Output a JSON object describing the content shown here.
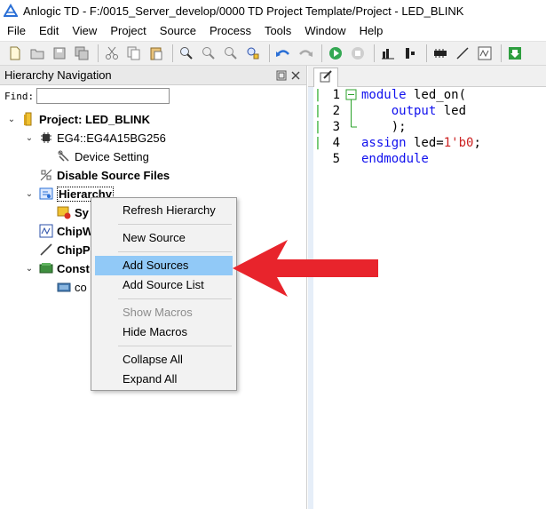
{
  "window": {
    "title": "Anlogic TD - F:/0015_Server_develop/0000 TD Project Template/Project - LED_BLINK"
  },
  "menubar": {
    "items": [
      "File",
      "Edit",
      "View",
      "Project",
      "Source",
      "Process",
      "Tools",
      "Window",
      "Help"
    ]
  },
  "toolbar": {
    "icons": [
      "new-file-icon",
      "open-folder-icon",
      "save-icon",
      "save-all-icon",
      "cut-icon",
      "copy-icon",
      "paste-icon",
      "zoom-in-icon",
      "zoom-fit-icon",
      "zoom-out-icon",
      "find-icon",
      "undo-icon",
      "redo-icon",
      "run-icon",
      "stop-icon",
      "bar-chart-icon",
      "step-icon",
      "chip-icon",
      "waveform-icon",
      "chipwatcher-icon",
      "download-icon"
    ]
  },
  "hierarchy_panel": {
    "title": "Hierarchy Navigation",
    "find_label": "Find:",
    "find_value": "",
    "tree": [
      {
        "label": "Project: LED_BLINK",
        "bold": true,
        "chevron": "down",
        "icon": "project-icon"
      },
      {
        "label": "EG4::EG4A15BG256",
        "bold": false,
        "chevron": "down",
        "icon": "chip-icon"
      },
      {
        "label": "Device Setting",
        "bold": false,
        "chevron": "",
        "icon": "setting-icon"
      },
      {
        "label": "Disable Source Files",
        "bold": true,
        "chevron": "",
        "icon": "disable-icon"
      },
      {
        "label": "Hierarchy",
        "bold": true,
        "chevron": "down",
        "icon": "hierarchy-icon"
      },
      {
        "label": "Sy",
        "bold": true,
        "chevron": "",
        "icon": "warning-module-icon"
      },
      {
        "label": "ChipW",
        "bold": true,
        "chevron": "",
        "icon": "chipwatcher-icon"
      },
      {
        "label": "ChipP",
        "bold": true,
        "chevron": "",
        "icon": "chipprobe-icon"
      },
      {
        "label": "Const",
        "bold": true,
        "chevron": "down",
        "icon": "constraints-icon"
      },
      {
        "label": "co",
        "bold": false,
        "chevron": "",
        "icon": "constraint-file-icon"
      }
    ]
  },
  "context_menu": {
    "items": [
      {
        "label": "Refresh Hierarchy",
        "state": "normal"
      },
      {
        "label": "New Source",
        "state": "normal"
      },
      {
        "label": "Add Sources",
        "state": "highlight"
      },
      {
        "label": "Add Source List",
        "state": "normal"
      },
      {
        "label": "Show Macros",
        "state": "disabled"
      },
      {
        "label": "Hide Macros",
        "state": "normal"
      },
      {
        "label": "Collapse All",
        "state": "normal"
      },
      {
        "label": "Expand All",
        "state": "normal"
      }
    ]
  },
  "editor": {
    "lines": [
      {
        "num": "1",
        "segments": [
          {
            "t": "module",
            "k": "kw"
          },
          {
            "t": " led_on(",
            "k": ""
          }
        ]
      },
      {
        "num": "2",
        "segments": [
          {
            "t": "    ",
            "k": ""
          },
          {
            "t": "output",
            "k": "kw"
          },
          {
            "t": " led",
            "k": ""
          }
        ]
      },
      {
        "num": "3",
        "segments": [
          {
            "t": "    );",
            "k": ""
          }
        ]
      },
      {
        "num": "4",
        "segments": [
          {
            "t": "assign",
            "k": "kw"
          },
          {
            "t": " led=",
            "k": ""
          },
          {
            "t": "1'b0",
            "k": "num"
          },
          {
            "t": ";",
            "k": ""
          }
        ]
      },
      {
        "num": "5",
        "segments": [
          {
            "t": "endmodule",
            "k": "kw"
          }
        ]
      }
    ]
  },
  "colors": {
    "highlight": "#91c9f7",
    "keyword": "#1111ee",
    "number": "#cc2222",
    "arrow": "#e8242c"
  }
}
